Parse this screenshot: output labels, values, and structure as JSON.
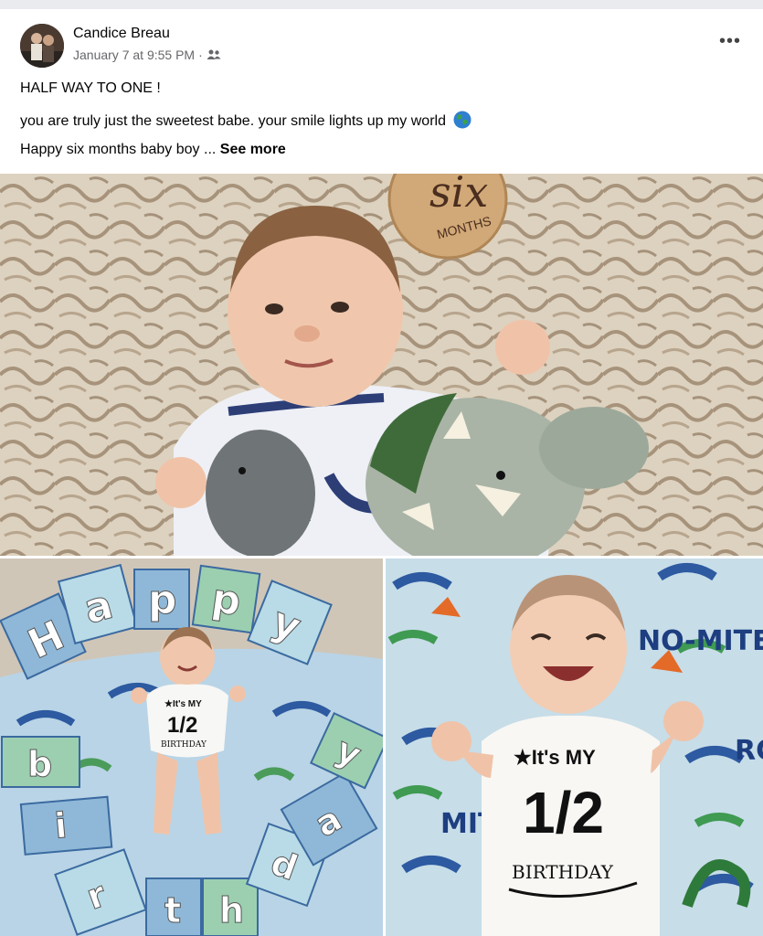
{
  "post": {
    "author": "Candice Breau",
    "timestamp": "January 7 at 9:55 PM",
    "separator": "·",
    "audience_icon": "friends-icon",
    "menu_icon": "more-options-icon",
    "menu_label": "•••",
    "text": {
      "line1": "HALF WAY TO ONE !",
      "line2": "you are truly just the sweetest babe. your smile lights up my world",
      "line2_emoji": "globe-emoji",
      "line3": "Happy six months baby boy ...",
      "see_more": "See more"
    }
  },
  "photos": [
    {
      "name": "main-photo",
      "milestone_sign": {
        "script": "six",
        "caption": "MONTHS"
      }
    },
    {
      "name": "letters-photo",
      "letters_top": [
        "H",
        "a",
        "p",
        "p",
        "y"
      ],
      "letters_bottom": [
        "b",
        "i",
        "r",
        "t",
        "h",
        "d",
        "a",
        "y"
      ],
      "onesie": {
        "line1": "★It's MY",
        "line2": "1/2",
        "line3": "BIRTHDAY"
      }
    },
    {
      "name": "laughing-photo",
      "blanket_text": [
        "NO-MITE",
        "RC",
        "MIT"
      ],
      "onesie": {
        "line1": "★It's MY",
        "line2": "1/2",
        "line3": "BIRTHDAY"
      }
    }
  ],
  "colors": {
    "background": "#e9ebee",
    "card": "#ffffff",
    "secondary_text": "#65676b",
    "fur": "#d9cdb8",
    "blanket": "#b9d4e6"
  }
}
